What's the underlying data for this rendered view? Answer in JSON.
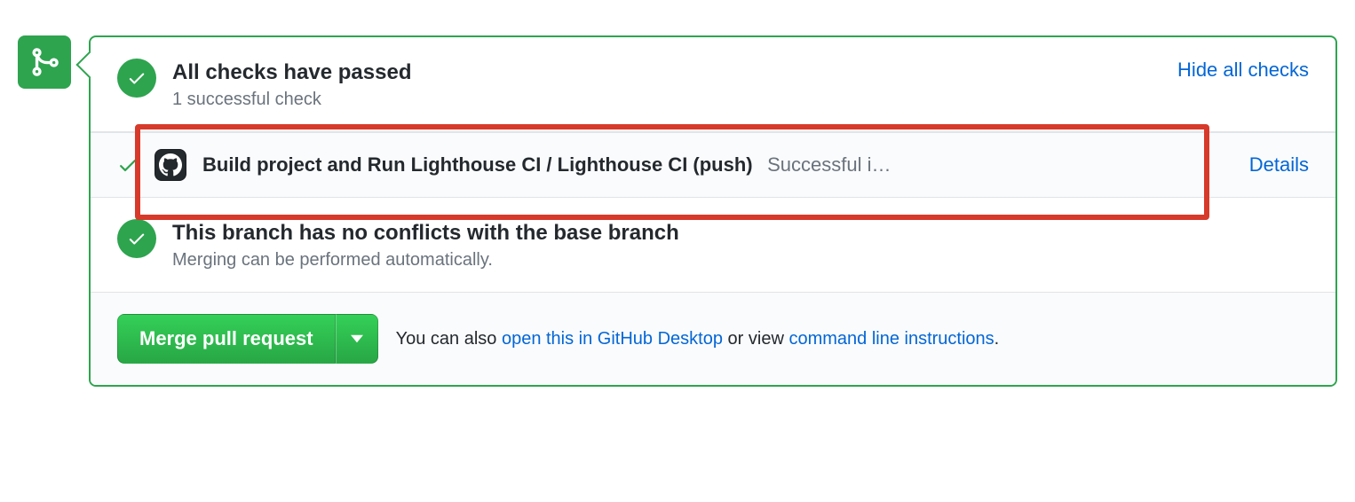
{
  "checks": {
    "title": "All checks have passed",
    "subtitle": "1 successful check",
    "toggle_label": "Hide all checks",
    "items": [
      {
        "name": "Build project and Run Lighthouse CI / Lighthouse CI (push)",
        "status_text": "Successful i…",
        "details_label": "Details"
      }
    ]
  },
  "conflicts": {
    "title": "This branch has no conflicts with the base branch",
    "subtitle": "Merging can be performed automatically."
  },
  "merge": {
    "button_label": "Merge pull request",
    "hint_prefix": "You can also ",
    "desktop_link": "open this in GitHub Desktop",
    "hint_middle": " or view ",
    "cli_link": "command line instructions",
    "hint_suffix": "."
  }
}
